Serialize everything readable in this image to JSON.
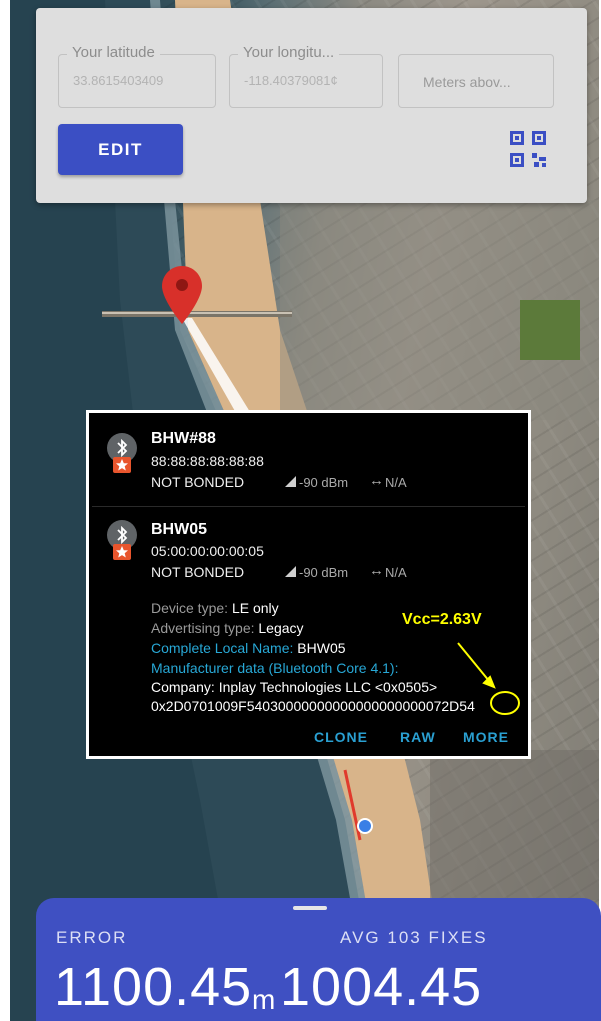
{
  "location_form": {
    "latitude_label": "Your latitude",
    "latitude_value": "33.8615403409",
    "longitude_label": "Your longitu...",
    "longitude_value": "-118.40379081¢",
    "altitude_placeholder": "Meters abov...",
    "edit_label": "EDIT"
  },
  "scan": {
    "devices": [
      {
        "name": "BHW#88",
        "mac": "88:88:88:88:88:88",
        "bond": "NOT BONDED",
        "rssi": "-90 dBm",
        "range": "N/A"
      },
      {
        "name": "BHW05",
        "mac": "05:00:00:00:00:05",
        "bond": "NOT BONDED",
        "rssi": "-90 dBm",
        "range": "N/A"
      }
    ],
    "details": {
      "device_type_label": "Device type: ",
      "device_type_value": "LE only",
      "adv_type_label": "Advertising type: ",
      "adv_type_value": "Legacy",
      "local_name_label": "Complete Local Name: ",
      "local_name_value": "BHW05",
      "manufacturer_label": "Manufacturer data (Bluetooth Core 4.1):",
      "company": "Company: Inplay Technologies LLC <0x0505>",
      "raw_data": "0x2D0701009F54030000000000000000000072D54"
    },
    "actions": [
      "CLONE",
      "RAW",
      "MORE"
    ]
  },
  "annotation": {
    "text": "Vcc=2.63V",
    "color": "#ffff00"
  },
  "stats": {
    "error_label": "ERROR",
    "avg_label": "AVG 103 FIXES",
    "error_value": "1100.45",
    "unit": "m",
    "avg_value": "1004.45"
  },
  "colors": {
    "accent": "#3f50c2",
    "button": "#3b4fc4",
    "link": "#28a8d6",
    "pin": "#d8302a"
  },
  "icons": [
    "qr-code-icon",
    "map-pin-icon",
    "bluetooth-icon",
    "star-icon",
    "signal-icon",
    "range-arrows-icon",
    "location-dot-icon"
  ]
}
